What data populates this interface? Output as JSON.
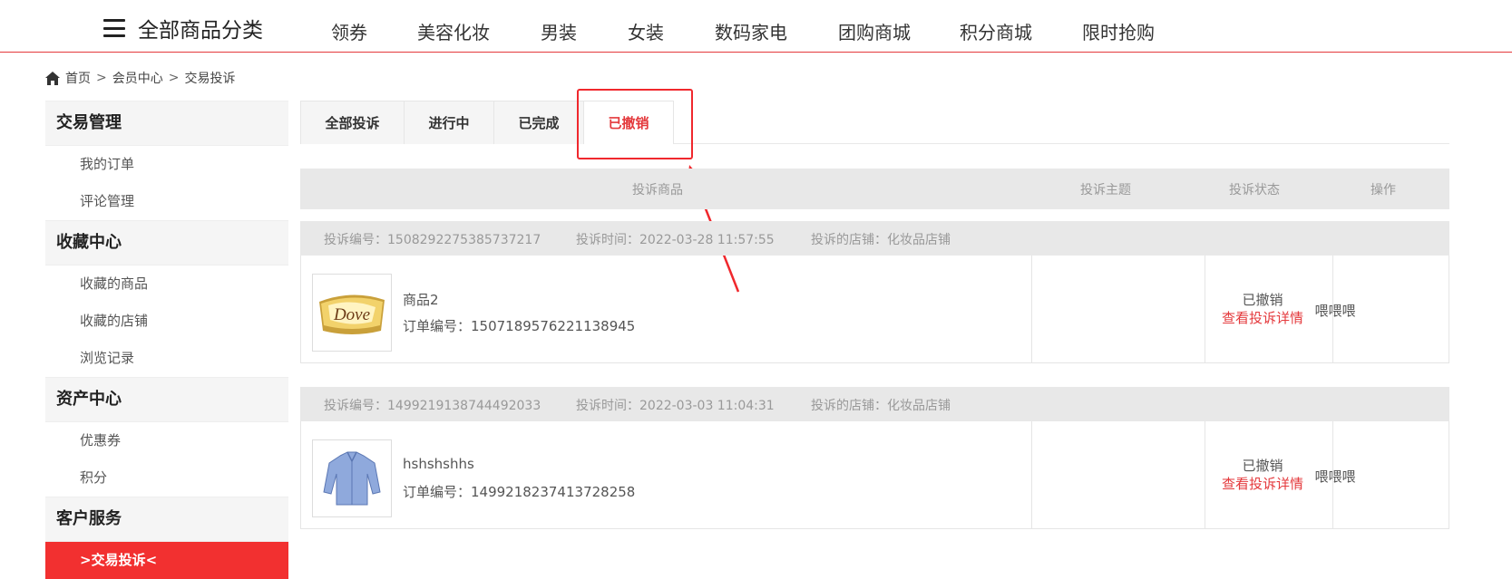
{
  "nav": {
    "all_categories": "全部商品分类",
    "items": [
      "领券",
      "美容化妆",
      "男装",
      "女装",
      "数码家电",
      "团购商城",
      "积分商城",
      "限时抢购"
    ]
  },
  "breadcrumb": [
    "首页",
    "会员中心",
    "交易投诉"
  ],
  "breadcrumb_sep": ">",
  "sidebar": {
    "sections": [
      {
        "title": "交易管理",
        "items": [
          "我的订单",
          "评论管理"
        ]
      },
      {
        "title": "收藏中心",
        "items": [
          "收藏的商品",
          "收藏的店铺",
          "浏览记录"
        ]
      },
      {
        "title": "资产中心",
        "items": [
          "优惠券",
          "积分"
        ]
      },
      {
        "title": "客户服务",
        "items": []
      }
    ],
    "active_item": ">交易投诉<"
  },
  "tabs": [
    "全部投诉",
    "进行中",
    "已完成",
    "已撤销"
  ],
  "active_tab": "已撤销",
  "table_header": {
    "product": "投诉商品",
    "subject": "投诉主题",
    "status": "投诉状态",
    "action": "操作"
  },
  "complaints": [
    {
      "no_label": "投诉编号：1508292275385737217",
      "time_label": "投诉时间：2022-03-28 11:57:55",
      "shop_label": "投诉的店铺：化妆品店铺",
      "product_name": "商品2",
      "order_label": "订单编号：1507189576221138945",
      "subject": "喂喂喂",
      "status": "已撤销",
      "detail_link": "查看投诉详情",
      "thumb": "dove-chocolate"
    },
    {
      "no_label": "投诉编号：1499219138744492033",
      "time_label": "投诉时间：2022-03-03 11:04:31",
      "shop_label": "投诉的店铺：化妆品店铺",
      "product_name": "hshshshhs",
      "order_label": "订单编号：1499218237413728258",
      "subject": "喂喂喂",
      "status": "已撤销",
      "detail_link": "查看投诉详情",
      "thumb": "blue-shirt"
    }
  ],
  "colors": {
    "accent": "#e4393c",
    "active_bg": "#f23030",
    "header_bg": "#e8e8e8"
  }
}
